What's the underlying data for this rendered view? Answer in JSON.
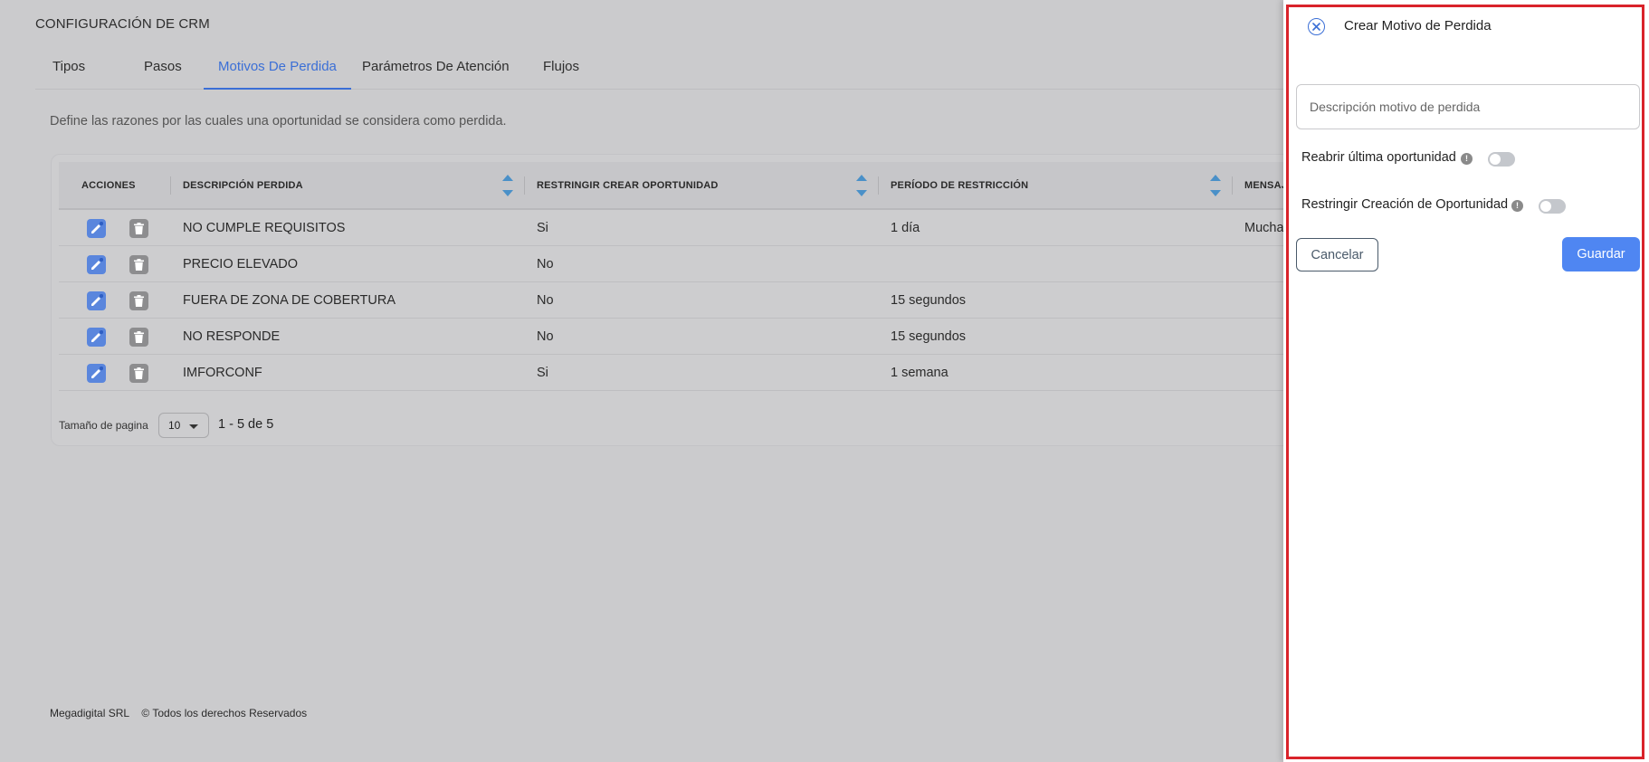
{
  "page": {
    "title": "CONFIGURACIÓN DE CRM",
    "description": "Define las razones por las cuales una oportunidad se considera como perdida."
  },
  "tabs": [
    {
      "label": "Tipos",
      "active": false
    },
    {
      "label": "Pasos",
      "active": false
    },
    {
      "label": "Motivos De Perdida",
      "active": true
    },
    {
      "label": "Parámetros De Atención",
      "active": false
    },
    {
      "label": "Flujos",
      "active": false
    }
  ],
  "table": {
    "headers": {
      "actions": "ACCIONES",
      "description": "DESCRIPCIÓN PERDIDA",
      "restrict": "RESTRINGIR CREAR OPORTUNIDAD",
      "period": "PERÍODO DE RESTRICCIÓN",
      "message": "MENSAJ"
    },
    "rows": [
      {
        "description": "NO CUMPLE REQUISITOS",
        "restrict": "Si",
        "period": "1 día",
        "message": "Mucha"
      },
      {
        "description": "PRECIO ELEVADO",
        "restrict": "No",
        "period": "",
        "message": ""
      },
      {
        "description": "FUERA DE ZONA DE COBERTURA",
        "restrict": "No",
        "period": "15 segundos",
        "message": ""
      },
      {
        "description": "NO RESPONDE",
        "restrict": "No",
        "period": "15 segundos",
        "message": ""
      },
      {
        "description": "IMFORCONF",
        "restrict": "Si",
        "period": "1 semana",
        "message": ""
      }
    ]
  },
  "pager": {
    "label": "Tamaño de pagina",
    "page_size": "10",
    "range": "1 - 5 de 5"
  },
  "footer": {
    "company": "Megadigital SRL",
    "rights": "© Todos los derechos Reservados"
  },
  "panel": {
    "title": "Crear Motivo de Perdida",
    "description_placeholder": "Descripción motivo de perdida",
    "description_value": "",
    "reopen_label": "Reabrir última oportunidad",
    "reopen_on": false,
    "restrict_label": "Restringir Creación de Oportunidad",
    "restrict_on": false,
    "info_glyph": "!",
    "cancel_label": "Cancelar",
    "save_label": "Guardar"
  },
  "colors": {
    "accent": "#3b6fd6",
    "save_button": "#4f86f2",
    "edit_button": "#5a86dd",
    "delete_button": "#8d8d8f",
    "highlight_outline": "#d9232a"
  }
}
